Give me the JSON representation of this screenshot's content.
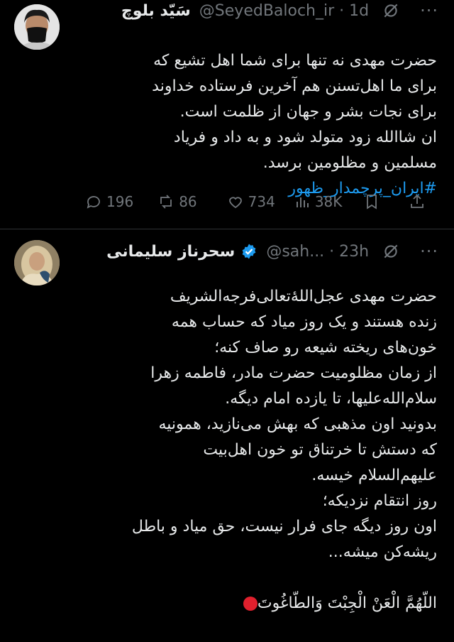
{
  "tweets": [
    {
      "display_name": "سَیّد بلوچ",
      "handle_time": "@SeyedBaloch_ir · 1d",
      "body": "حضرت مهدی نه تنها برای شما اهل تشیع که\nبرای ما اهل‌تسنن هم آخرین فرستاده خداوند\nبرای نجات بشر و جهان از ظلمت است.\nان شاالله زود متولد شود و به داد و فریاد\nمسلمین و مظلومین برسد.",
      "hashtag": "#ایران_پرچمدار_ظهور",
      "stats": {
        "replies": "196",
        "reposts": "86",
        "likes": "734",
        "views": "38K"
      }
    },
    {
      "display_name": "سحرناز سلیمانی",
      "handle_time": "@sah... · 23h",
      "body": "حضرت مهدی عجل‌اللهٔ‌تعالی‌فرجه‌الشریف\nزنده هستند و یک روز میاد که حساب همه\nخون‌های ریخته شیعه رو صاف کنه؛\nاز زمان مظلومیت حضرت مادر، فاطمه زهرا\nسلام‌الله‌علیها، تا یازده امام دیگه.\nبدونید اون مذهبی که بهش می‌نازید، همونیه\nکه دستش تا خرتناق تو خون اهل‌بیت\nعلیهم‌السلام خیسه.\nروز انتقام نزدیکه؛\nاون روز دیگه جای فرار نیست، حق میاد و باطل\nریشه‌کن میشه...",
      "last_line": "اللّهُمَّ الْعَنْ الْجِبْتَ وَالطّاغُوتَ"
    }
  ],
  "colors": {
    "background": "#000000",
    "text": "#e7e9ea",
    "muted": "#71767b",
    "link": "#1d9bf0",
    "verified": "#1d9bf0"
  }
}
